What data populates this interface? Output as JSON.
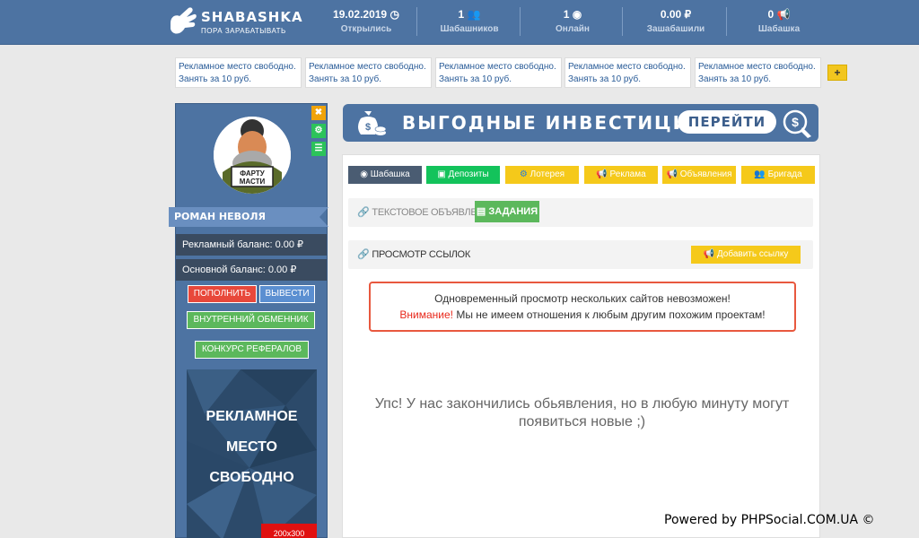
{
  "header": {
    "logo_title": "SHABASHKA",
    "logo_subtitle": "ПОРА ЗАРАБАТЫВАТЬ",
    "stats": [
      {
        "value": "19.02.2019",
        "icon": "clock-icon",
        "label": "Открылись"
      },
      {
        "value": "1",
        "icon": "users-icon",
        "label": "Шабашников"
      },
      {
        "value": "1",
        "icon": "eye-icon",
        "label": "Онлайн"
      },
      {
        "value": "0.00",
        "icon": "ruble-icon",
        "label": "Зашабашили"
      },
      {
        "value": "0",
        "icon": "megaphone-icon",
        "label": "Шабашка"
      }
    ]
  },
  "ad_strip": {
    "slots": [
      {
        "line1": "Рекламное место свободно.",
        "line2": "Занять за 10 руб."
      },
      {
        "line1": "Рекламное место свободно.",
        "line2": "Занять за 10 руб."
      },
      {
        "line1": "Рекламное место свободно.",
        "line2": "Занять за 10 руб."
      },
      {
        "line1": "Рекламное место свободно.",
        "line2": "Занять за 10 руб."
      },
      {
        "line1": "Рекламное место свободно.",
        "line2": "Занять за 10 руб."
      }
    ],
    "add_label": "+"
  },
  "profile": {
    "mini_buttons": {
      "close": "✖",
      "settings": "⚙",
      "menu": "☰"
    },
    "avatar_text": {
      "line1": "ФАРТУ",
      "line2": "МАСТИ"
    },
    "name": "РОМАН НЕВОЛЯ",
    "ad_balance": "Рекламный баланс: 0.00 ₽",
    "main_balance": "Основной баланс: 0.00 ₽",
    "topup_label": "ПОПОЛНИТЬ",
    "withdraw_label": "ВЫВЕСТИ",
    "exchange_label": "ВНУТРЕННИЙ ОБМЕННИК",
    "referral_label": "КОНКУРС РЕФЕРАЛОВ",
    "banner": {
      "line1": "РЕКЛАМНОЕ",
      "line2": "МЕСТО",
      "line3": "СВОБОДНО",
      "size": "200x300"
    }
  },
  "invest": {
    "title": "ВЫГОДНЫЕ ИНВЕСТИЦИИ",
    "button": "ПЕРЕЙТИ"
  },
  "tabs": [
    {
      "label": "Шабашка",
      "icon": "eye-icon",
      "style": "dark"
    },
    {
      "label": "Депозиты",
      "icon": "money-icon",
      "style": "green"
    },
    {
      "label": "Лотерея",
      "icon": "gear-icon",
      "style": "yellow"
    },
    {
      "label": "Реклама",
      "icon": "megaphone-icon",
      "style": "yellow"
    },
    {
      "label": "Объявления",
      "icon": "megaphone-icon",
      "style": "yellow"
    },
    {
      "label": "Бригада",
      "icon": "users-icon",
      "style": "yellow"
    }
  ],
  "section1": {
    "title": "ТЕКСТОВОЕ ОБЪЯВЛЕНИЕ",
    "tasks_label": "ЗАДАНИЯ"
  },
  "section2": {
    "title": "ПРОСМОТР ССЫЛОК",
    "add_link_label": "Добавить ссылку"
  },
  "alert": {
    "line1": "Одновременный просмотр нескольких сайтов невозможен!",
    "warn": "Внимание!",
    "line2": " Мы не имеем отношения к любым другим похожим проектам!"
  },
  "empty_message": {
    "line1": "Упс! У нас закончились обьявления, но в любую минуту могут",
    "line2": "появиться новые ;)"
  },
  "footer": {
    "powered": "Powered by PHPSocial.COM.UA ©"
  },
  "colors": {
    "primary": "#4d73a2",
    "green": "#5cb85c",
    "yellow": "#f5c91a",
    "red": "#e8483b"
  }
}
